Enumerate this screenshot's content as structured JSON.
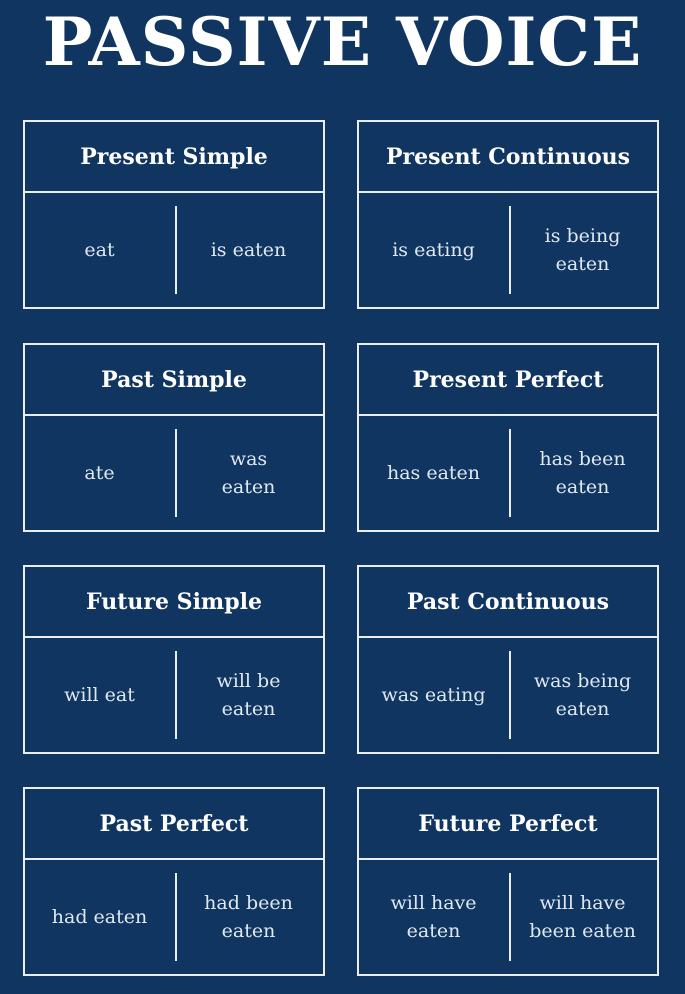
{
  "title": "PASSIVE VOICE",
  "cards": [
    {
      "tense": "Present Simple",
      "active": "eat",
      "passive": "is eaten"
    },
    {
      "tense": "Present Continuous",
      "active": "is eating",
      "passive": "is being\neaten"
    },
    {
      "tense": "Past Simple",
      "active": "ate",
      "passive": "was\neaten"
    },
    {
      "tense": "Present Perfect",
      "active": "has eaten",
      "passive": "has been\neaten"
    },
    {
      "tense": "Future Simple",
      "active": "will eat",
      "passive": "will be\neaten"
    },
    {
      "tense": "Past Continuous",
      "active": "was eating",
      "passive": "was being\neaten"
    },
    {
      "tense": "Past Perfect",
      "active": "had eaten",
      "passive": "had been\neaten"
    },
    {
      "tense": "Future Perfect",
      "active": "will have\neaten",
      "passive": "will have\nbeen eaten"
    }
  ],
  "colors": {
    "background": "#0f3560",
    "border": "#e9eef4",
    "text": "#ffffff"
  }
}
